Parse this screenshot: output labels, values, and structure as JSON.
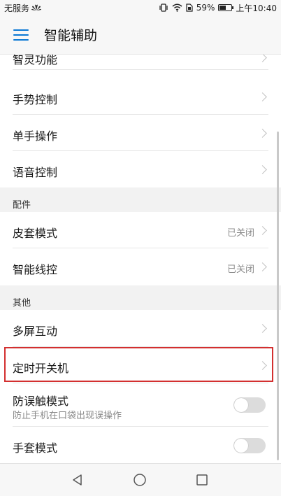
{
  "status_bar": {
    "carrier": "无服务",
    "battery_percent": "59%",
    "battery_level": 0.59,
    "time": "上午10:40"
  },
  "header": {
    "title": "智能辅助"
  },
  "sections": {
    "main_items": [
      {
        "label": "智灵功能"
      },
      {
        "label": "手势控制"
      },
      {
        "label": "单手操作"
      },
      {
        "label": "语音控制"
      }
    ],
    "accessories": {
      "header": "配件",
      "items": [
        {
          "label": "皮套模式",
          "value": "已关闭"
        },
        {
          "label": "智能线控",
          "value": "已关闭"
        }
      ]
    },
    "others": {
      "header": "其他",
      "items": [
        {
          "label": "多屏互动"
        },
        {
          "label": "定时开关机"
        },
        {
          "label": "防误触模式",
          "subtitle": "防止手机在口袋出现误操作",
          "toggle": false
        },
        {
          "label": "手套模式",
          "toggle": false
        }
      ]
    }
  },
  "colors": {
    "accent": "#0a78d4",
    "highlight": "#d32f2f"
  }
}
